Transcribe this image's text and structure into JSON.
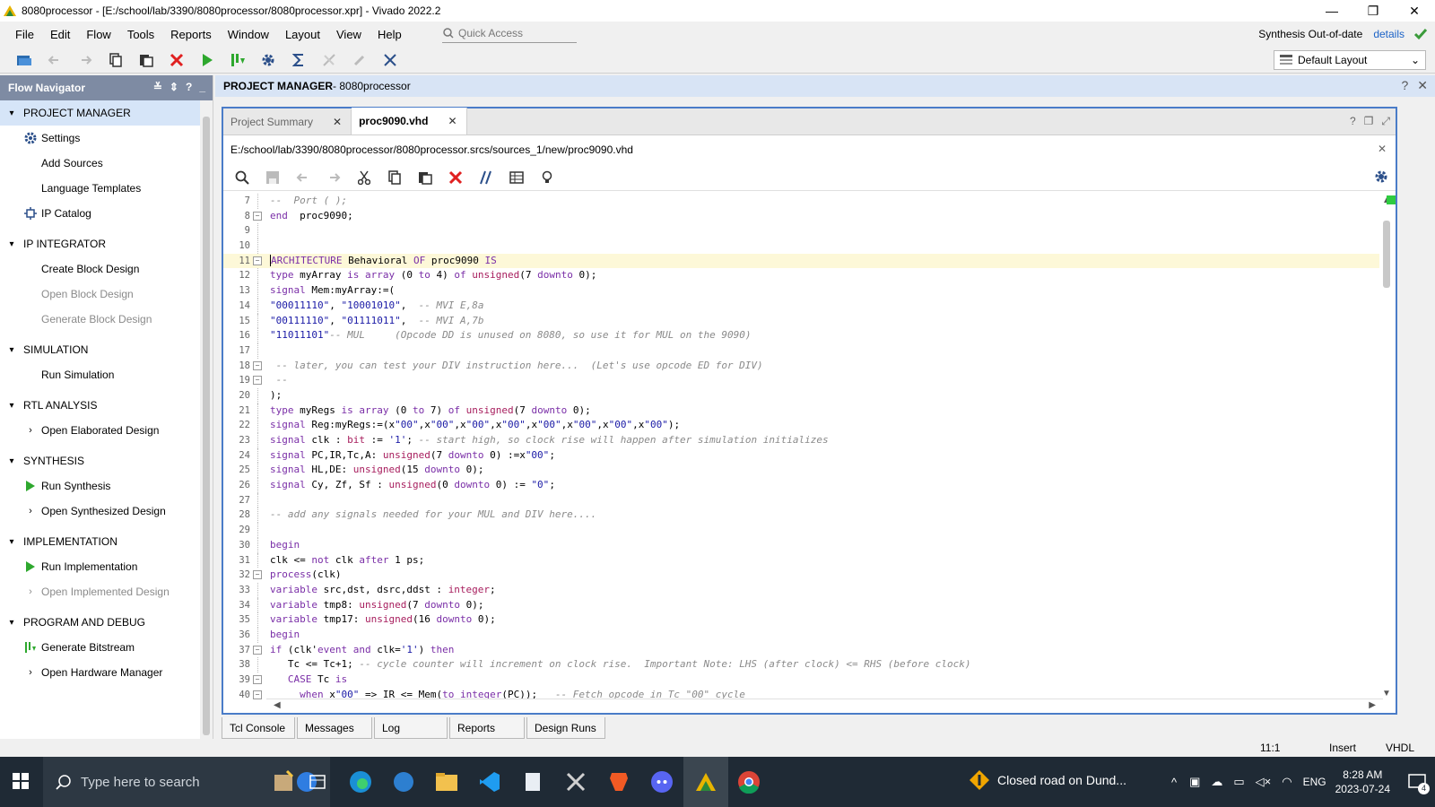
{
  "window": {
    "title": "8080processor - [E:/school/lab/3390/8080processor/8080processor.xpr] - Vivado 2022.2",
    "minimize": "—",
    "restore": "❐",
    "close": "✕"
  },
  "menu": {
    "items": [
      "File",
      "Edit",
      "Flow",
      "Tools",
      "Reports",
      "Window",
      "Layout",
      "View",
      "Help"
    ],
    "quick_access_placeholder": "Quick Access",
    "synth_status": "Synthesis Out-of-date",
    "details_link": "details"
  },
  "toolbar": {
    "layout_select": "Default Layout"
  },
  "flow_navigator": {
    "title": "Flow Navigator",
    "sections": [
      {
        "label": "PROJECT MANAGER",
        "items": [
          {
            "label": "Settings",
            "icon": "gear-icon"
          },
          {
            "label": "Add Sources"
          },
          {
            "label": "Language Templates"
          },
          {
            "label": "IP Catalog",
            "icon": "ip-catalog-icon"
          }
        ]
      },
      {
        "label": "IP INTEGRATOR",
        "items": [
          {
            "label": "Create Block Design"
          },
          {
            "label": "Open Block Design",
            "disabled": true
          },
          {
            "label": "Generate Block Design",
            "disabled": true
          }
        ]
      },
      {
        "label": "SIMULATION",
        "items": [
          {
            "label": "Run Simulation"
          }
        ]
      },
      {
        "label": "RTL ANALYSIS",
        "items": [
          {
            "label": "Open Elaborated Design"
          }
        ]
      },
      {
        "label": "SYNTHESIS",
        "items": [
          {
            "label": "Run Synthesis",
            "icon": "run-icon"
          },
          {
            "label": "Open Synthesized Design"
          }
        ]
      },
      {
        "label": "IMPLEMENTATION",
        "items": [
          {
            "label": "Run Implementation",
            "icon": "run-icon"
          },
          {
            "label": "Open Implemented Design",
            "disabled": true
          }
        ]
      },
      {
        "label": "PROGRAM AND DEBUG",
        "items": [
          {
            "label": "Generate Bitstream",
            "icon": "bitstream-icon"
          },
          {
            "label": "Open Hardware Manager"
          }
        ]
      }
    ]
  },
  "project_manager": {
    "header_bold": "PROJECT MANAGER",
    "header_rest": " - 8080processor",
    "help": "?",
    "close": "✕"
  },
  "editor": {
    "tabs": [
      {
        "label": "Project Summary",
        "active": false
      },
      {
        "label": "proc9090.vhd",
        "active": true
      }
    ],
    "file_path": "E:/school/lab/3390/8080processor/8080processor.srcs/sources_1/new/proc9090.vhd",
    "status": {
      "position": "11:1",
      "mode": "Insert",
      "language": "VHDL"
    }
  },
  "code": {
    "line_numbers": [
      "7",
      "8",
      "9",
      "10",
      "11",
      "12",
      "13",
      "14",
      "15",
      "16",
      "17",
      "18",
      "19",
      "20",
      "21",
      "22",
      "23",
      "24",
      "25",
      "26",
      "27",
      "28",
      "29",
      "30",
      "31",
      "32",
      "33",
      "34",
      "35",
      "36",
      "37",
      "38",
      "39",
      "40"
    ],
    "lines": [
      [
        [
          "cm",
          "--  Port ( );"
        ]
      ],
      [
        [
          "kw",
          "end"
        ],
        [
          "",
          "  proc9090;"
        ]
      ],
      [],
      [],
      [
        [
          "kw",
          "ARCHITECTURE"
        ],
        [
          "",
          " Behavioral "
        ],
        [
          "kw",
          "OF"
        ],
        [
          "",
          " proc9090 "
        ],
        [
          "kw",
          "IS"
        ]
      ],
      [
        [
          "kw",
          "type"
        ],
        [
          "",
          " myArray "
        ],
        [
          "kw",
          "is"
        ],
        [
          "",
          " "
        ],
        [
          "kw",
          "array"
        ],
        [
          "",
          " (0 "
        ],
        [
          "kw",
          "to"
        ],
        [
          "",
          " 4) "
        ],
        [
          "kw",
          "of"
        ],
        [
          "",
          " "
        ],
        [
          "ty",
          "unsigned"
        ],
        [
          "",
          "(7 "
        ],
        [
          "kw",
          "downto"
        ],
        [
          "",
          " 0);"
        ]
      ],
      [
        [
          "kw",
          "signal"
        ],
        [
          "",
          " Mem:myArray:=("
        ]
      ],
      [
        [
          "st",
          "\"00011110\""
        ],
        [
          "",
          ", "
        ],
        [
          "st",
          "\"10001010\""
        ],
        [
          "",
          ",  "
        ],
        [
          "cm",
          "-- MVI E,8a"
        ]
      ],
      [
        [
          "st",
          "\"00111110\""
        ],
        [
          "",
          ", "
        ],
        [
          "st",
          "\"01111011\""
        ],
        [
          "",
          ",  "
        ],
        [
          "cm",
          "-- MVI A,7b"
        ]
      ],
      [
        [
          "st",
          "\"11011101\""
        ],
        [
          "cm",
          "-- MUL     (Opcode DD is unused on 8080, so use it for MUL on the 9090)"
        ]
      ],
      [],
      [
        [
          "cm",
          " -- later, you can test your DIV instruction here...  (Let's use opcode ED for DIV)"
        ]
      ],
      [
        [
          "cm",
          " --"
        ]
      ],
      [
        [
          "",
          ");"
        ]
      ],
      [
        [
          "kw",
          "type"
        ],
        [
          "",
          " myRegs "
        ],
        [
          "kw",
          "is"
        ],
        [
          "",
          " "
        ],
        [
          "kw",
          "array"
        ],
        [
          "",
          " (0 "
        ],
        [
          "kw",
          "to"
        ],
        [
          "",
          " 7) "
        ],
        [
          "kw",
          "of"
        ],
        [
          "",
          " "
        ],
        [
          "ty",
          "unsigned"
        ],
        [
          "",
          "(7 "
        ],
        [
          "kw",
          "downto"
        ],
        [
          "",
          " 0);"
        ]
      ],
      [
        [
          "kw",
          "signal"
        ],
        [
          "",
          " Reg:myRegs:=(x"
        ],
        [
          "st",
          "\"00\""
        ],
        [
          "",
          ",x"
        ],
        [
          "st",
          "\"00\""
        ],
        [
          "",
          ",x"
        ],
        [
          "st",
          "\"00\""
        ],
        [
          "",
          ",x"
        ],
        [
          "st",
          "\"00\""
        ],
        [
          "",
          ",x"
        ],
        [
          "st",
          "\"00\""
        ],
        [
          "",
          ",x"
        ],
        [
          "st",
          "\"00\""
        ],
        [
          "",
          ",x"
        ],
        [
          "st",
          "\"00\""
        ],
        [
          "",
          ",x"
        ],
        [
          "st",
          "\"00\""
        ],
        [
          "",
          ");"
        ]
      ],
      [
        [
          "kw",
          "signal"
        ],
        [
          "",
          " clk : "
        ],
        [
          "ty",
          "bit"
        ],
        [
          "",
          " := "
        ],
        [
          "st",
          "'1'"
        ],
        [
          "",
          "; "
        ],
        [
          "cm",
          "-- start high, so clock rise will happen after simulation initializes"
        ]
      ],
      [
        [
          "kw",
          "signal"
        ],
        [
          "",
          " PC,IR,Tc,A: "
        ],
        [
          "ty",
          "unsigned"
        ],
        [
          "",
          "(7 "
        ],
        [
          "kw",
          "downto"
        ],
        [
          "",
          " 0) :=x"
        ],
        [
          "st",
          "\"00\""
        ],
        [
          "",
          ";"
        ]
      ],
      [
        [
          "kw",
          "signal"
        ],
        [
          "",
          " HL,DE: "
        ],
        [
          "ty",
          "unsigned"
        ],
        [
          "",
          "(15 "
        ],
        [
          "kw",
          "downto"
        ],
        [
          "",
          " 0);"
        ]
      ],
      [
        [
          "kw",
          "signal"
        ],
        [
          "",
          " Cy, Zf, Sf : "
        ],
        [
          "ty",
          "unsigned"
        ],
        [
          "",
          "(0 "
        ],
        [
          "kw",
          "downto"
        ],
        [
          "",
          " 0) := "
        ],
        [
          "st",
          "\"0\""
        ],
        [
          "",
          ";"
        ]
      ],
      [],
      [
        [
          "cm",
          "-- add any signals needed for your MUL and DIV here...."
        ]
      ],
      [],
      [
        [
          "kw",
          "begin"
        ]
      ],
      [
        [
          "",
          "clk <= "
        ],
        [
          "kw",
          "not"
        ],
        [
          "",
          " clk "
        ],
        [
          "kw",
          "after"
        ],
        [
          "",
          " 1 ps;"
        ]
      ],
      [
        [
          "kw",
          "process"
        ],
        [
          "",
          "(clk)"
        ]
      ],
      [
        [
          "kw",
          "variable"
        ],
        [
          "",
          " src,dst, dsrc,ddst : "
        ],
        [
          "ty",
          "integer"
        ],
        [
          "",
          ";"
        ]
      ],
      [
        [
          "kw",
          "variable"
        ],
        [
          "",
          " tmp8: "
        ],
        [
          "ty",
          "unsigned"
        ],
        [
          "",
          "(7 "
        ],
        [
          "kw",
          "downto"
        ],
        [
          "",
          " 0);"
        ]
      ],
      [
        [
          "kw",
          "variable"
        ],
        [
          "",
          " tmp17: "
        ],
        [
          "ty",
          "unsigned"
        ],
        [
          "",
          "(16 "
        ],
        [
          "kw",
          "downto"
        ],
        [
          "",
          " 0);"
        ]
      ],
      [
        [
          "kw",
          "begin"
        ]
      ],
      [
        [
          "kw",
          "if"
        ],
        [
          "",
          " (clk'"
        ],
        [
          "kw",
          "event"
        ],
        [
          "",
          " "
        ],
        [
          "kw",
          "and"
        ],
        [
          "",
          " clk="
        ],
        [
          "st",
          "'1'"
        ],
        [
          "",
          ") "
        ],
        [
          "kw",
          "then"
        ]
      ],
      [
        [
          "",
          "   Tc <= Tc+1; "
        ],
        [
          "cm",
          "-- cycle counter will increment on clock rise.  Important Note: LHS (after clock) <= RHS (before clock)"
        ]
      ],
      [
        [
          "",
          "   "
        ],
        [
          "kw",
          "CASE"
        ],
        [
          "",
          " Tc "
        ],
        [
          "kw",
          "is"
        ]
      ],
      [
        [
          "",
          "     "
        ],
        [
          "kw",
          "when"
        ],
        [
          "",
          " x"
        ],
        [
          "st",
          "\"00\""
        ],
        [
          "",
          " => IR <= Mem("
        ],
        [
          "kw",
          "to_integer"
        ],
        [
          "",
          "(PC));   "
        ],
        [
          "cm",
          "-- Fetch opcode in Tc \"00\" cycle"
        ]
      ]
    ],
    "folds": [
      "8",
      "11",
      "18",
      "19",
      "32",
      "37",
      "39",
      "40"
    ]
  },
  "bottom_tabs": [
    "Tcl Console",
    "Messages",
    "Log",
    "Reports",
    "Design Runs"
  ],
  "taskbar": {
    "search_placeholder": "Type here to search",
    "notification": "Closed road on Dund...",
    "language": "ENG",
    "time": "8:28 AM",
    "date": "2023-07-24",
    "notif_count": "4"
  }
}
